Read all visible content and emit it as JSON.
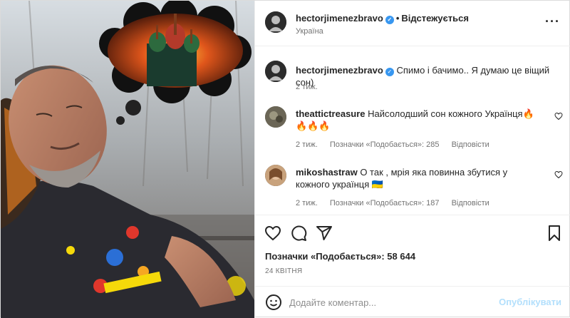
{
  "post": {
    "username": "hectorjimenezbravo",
    "verified": true,
    "follow_status": "Відстежується",
    "location": "Україна",
    "more_icon": "more-horizontal-icon"
  },
  "caption": {
    "username": "hectorjimenezbravo",
    "text": "Спимо і бачимо.. Я думаю це віщий сон)",
    "time": "2 тиж."
  },
  "comments": [
    {
      "username": "theattictreasure",
      "text": "Найсолодший сон кожного Українця🔥🔥🔥🔥",
      "time": "2 тиж.",
      "likes_label": "Позначки «Подобається»: 285",
      "reply_label": "Відповісти"
    },
    {
      "username": "mikoshastraw",
      "text": "О так , мрія яка повинна збутися у кожного українця 🇺🇦",
      "time": "2 тиж.",
      "likes_label": "Позначки «Подобається»: 187",
      "reply_label": "Відповісти"
    }
  ],
  "actions": {
    "icons": [
      "heart-icon",
      "comment-icon",
      "share-icon",
      "bookmark-icon"
    ],
    "likes_label": "Позначки «Подобається»: 58 644",
    "date": "24 КВІТНЯ"
  },
  "add_comment": {
    "placeholder": "Додайте коментар...",
    "post_label": "Опублікувати"
  },
  "colors": {
    "accent": "#0095f6",
    "post_disabled": "#b2dffc",
    "verified": "#3897f0",
    "muted": "#737373"
  }
}
